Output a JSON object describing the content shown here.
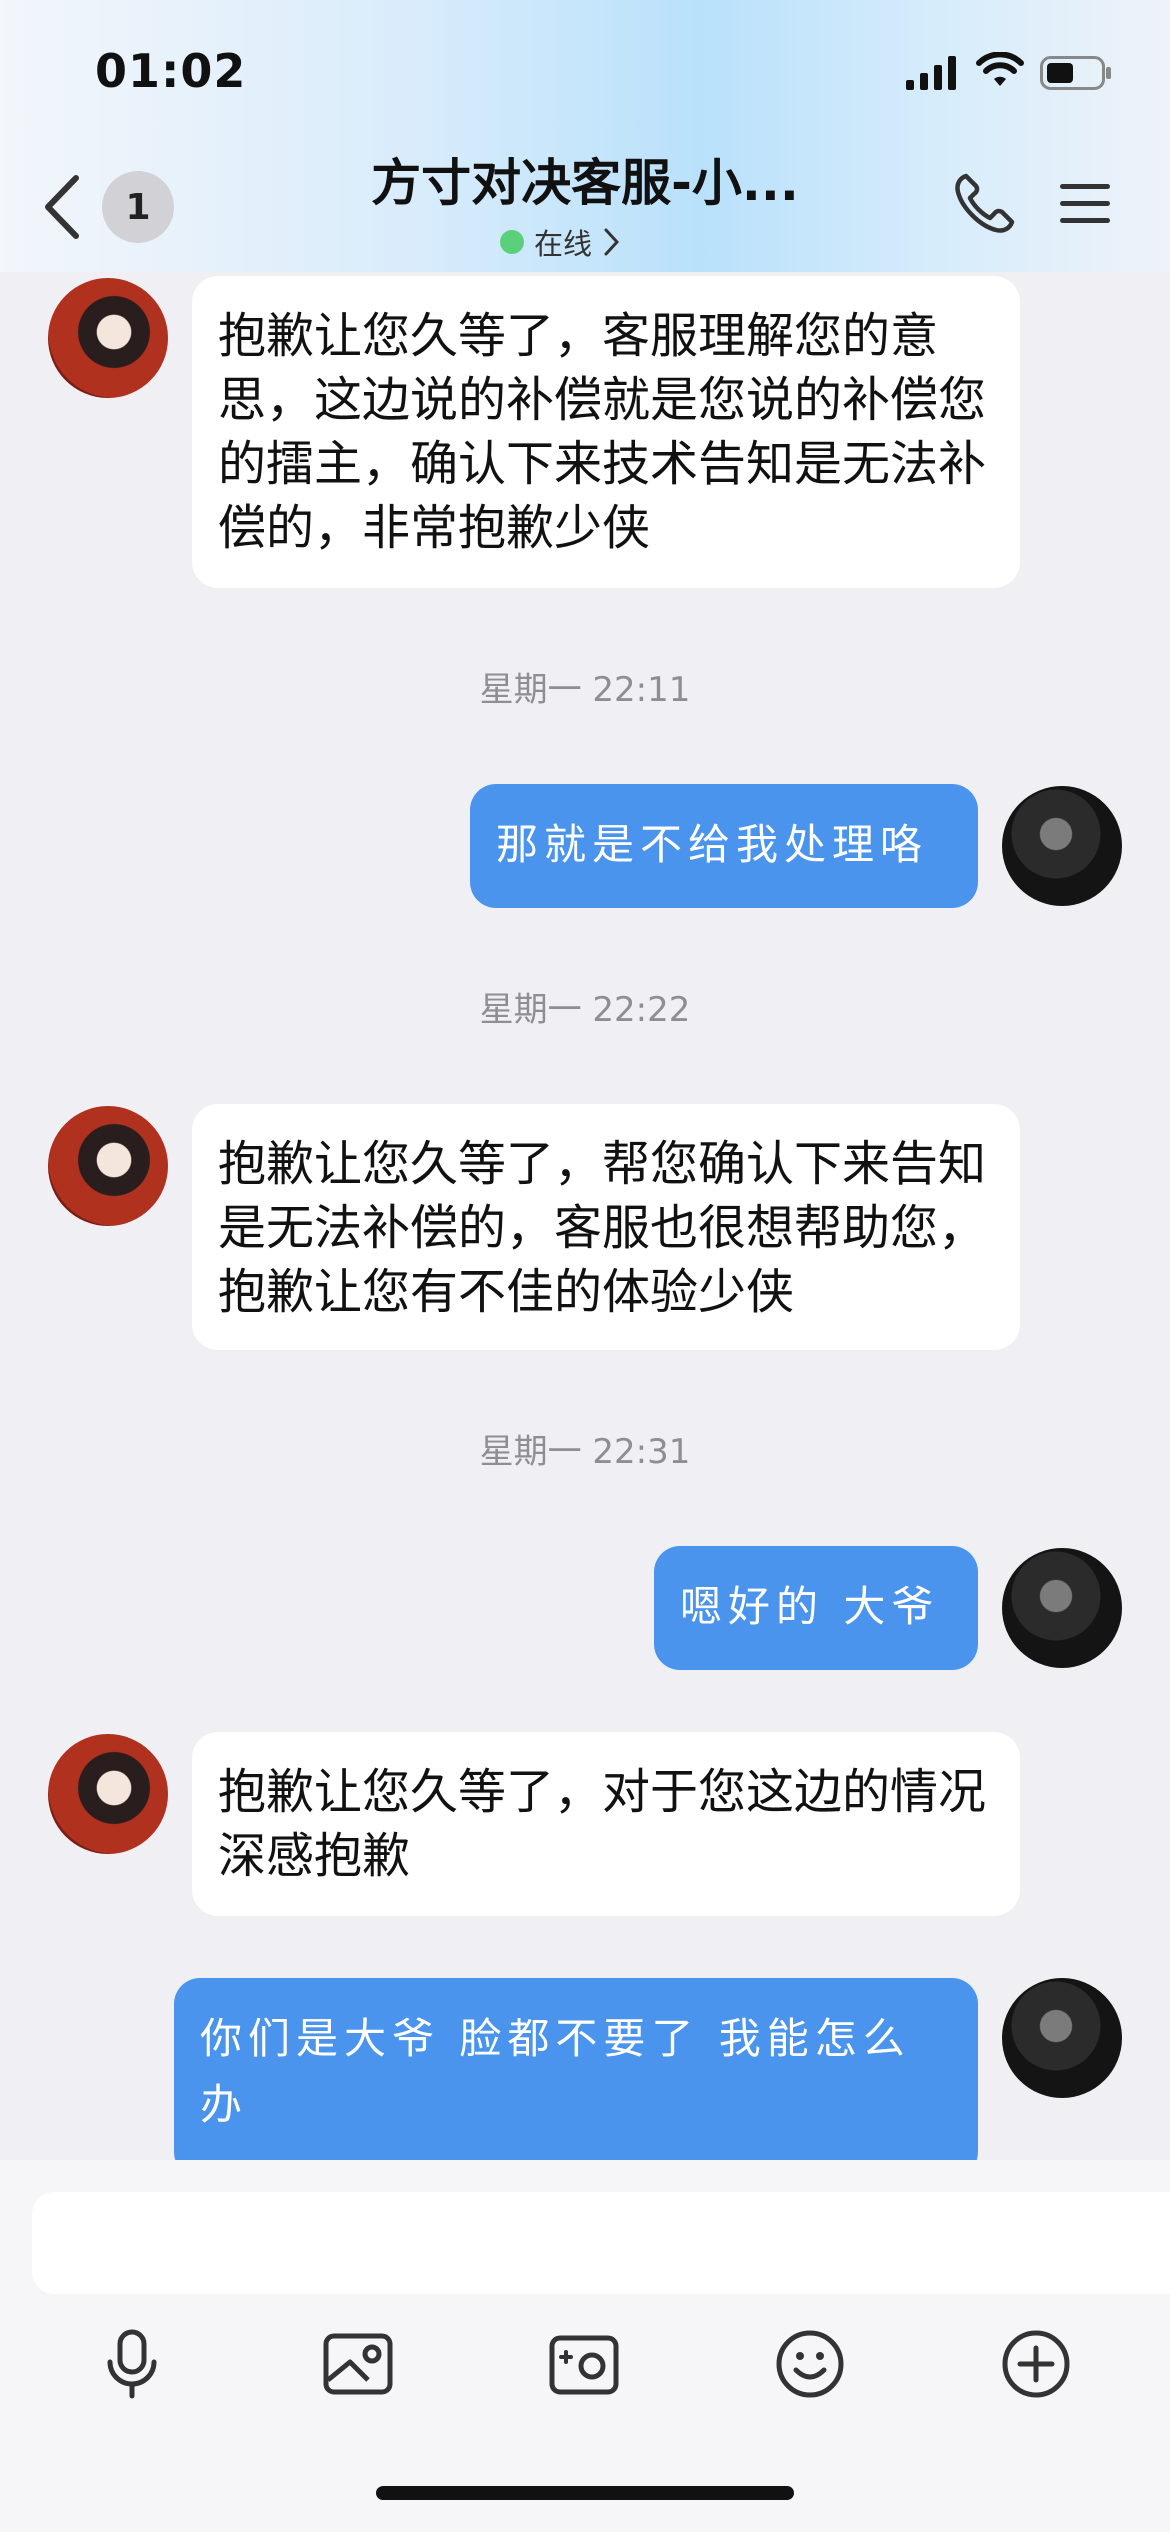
{
  "status_bar": {
    "time": "01:02"
  },
  "header": {
    "back_badge_count": "1",
    "title": "方寸对决客服-小...",
    "presence": "在线"
  },
  "messages": [
    {
      "side": "in",
      "text": "抱歉让您久等了，客服理解您的意思，这边说的补偿就是您说的补偿您的擂主，确认下来技术告知是无法补偿的，非常抱歉少侠"
    },
    {
      "type": "timestamp",
      "text": "星期一 22:11"
    },
    {
      "side": "out",
      "text": "那就是不给我处理咯"
    },
    {
      "type": "timestamp",
      "text": "星期一 22:22"
    },
    {
      "side": "in",
      "text": "抱歉让您久等了，帮您确认下来告知是无法补偿的，客服也很想帮助您，抱歉让您有不佳的体验少侠"
    },
    {
      "type": "timestamp",
      "text": "星期一 22:31"
    },
    {
      "side": "out",
      "text": "嗯好的 大爷"
    },
    {
      "side": "in",
      "text": "抱歉让您久等了，对于您这边的情况深感抱歉"
    },
    {
      "side": "out",
      "text": "你们是大爷 脸都不要了 我能怎么办"
    }
  ],
  "composer": {
    "input_value": ""
  },
  "toolbar_icons": [
    "microphone-icon",
    "image-icon",
    "camera-icon",
    "emoji-icon",
    "plus-circle-icon"
  ]
}
